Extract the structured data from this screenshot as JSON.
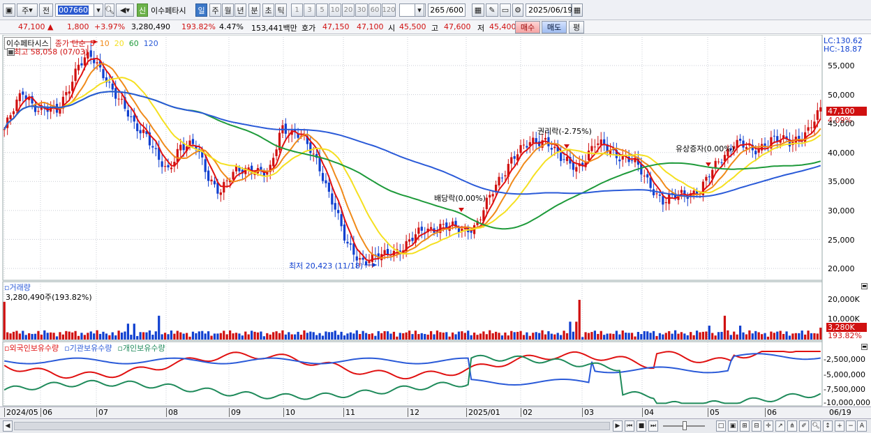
{
  "toolbar": {
    "market": "주",
    "prev": "전",
    "code": "007660",
    "new_badge": "신",
    "name": "이수페타시",
    "periods": [
      "일",
      "주",
      "월",
      "년",
      "분",
      "초",
      "틱"
    ],
    "intervals": [
      "1",
      "3",
      "5",
      "10",
      "20",
      "30",
      "60",
      "120"
    ],
    "count": "265",
    "count_max": "/600",
    "date": "2025/06/19"
  },
  "quote": {
    "price": "47,100",
    "change_arrow": "▲",
    "change": "1,800",
    "change_pct": "+3.97%",
    "volume": "3,280,490",
    "volume_pct": "193.82%",
    "turnover": "4.47%",
    "amount": "153,441백만",
    "hoga_label": "호가",
    "ask": "47,150",
    "bid": "47,100",
    "open_label": "시",
    "open": "45,500",
    "high_label": "고",
    "high": "47,600",
    "low_label": "저",
    "low": "45,400",
    "buy": "매수",
    "sell": "매도",
    "eval": "평"
  },
  "chart": {
    "legend": {
      "stock": "이수페타시스",
      "close_label": "종가 단순",
      "ma": [
        {
          "label": "5",
          "color": "#e01010"
        },
        {
          "label": "10",
          "color": "#f08a1a"
        },
        {
          "label": "20",
          "color": "#f5e020"
        },
        {
          "label": "60",
          "color": "#1e9a3a"
        },
        {
          "label": "120",
          "color": "#2a5ad8"
        }
      ]
    },
    "high_note": "최고 58,058 (07/03)",
    "low_note": "최저 20,423 (11/18)",
    "events": [
      "배당락(0.00%)",
      "권리락(-2.75%)",
      "유상증자(0.00%)"
    ],
    "lc": "LC:130.62",
    "hc": "HC:-18.87",
    "last_price_tag": "47,100",
    "last_pct_tag": "4.09%",
    "y_ticks": [
      "55,000",
      "50,000",
      "45,000",
      "40,000",
      "35,000",
      "30,000",
      "25,000",
      "20,000"
    ]
  },
  "volume_panel": {
    "title": "거래량",
    "value": "3,280,490주(193.82%)",
    "y_ticks": [
      "20,000K",
      "10,000K"
    ],
    "last_tag": "3,280K",
    "last_pct": "193.82%"
  },
  "holdings_panel": {
    "legend": [
      {
        "label": "외국인보유수량",
        "color": "#e01010"
      },
      {
        "label": "기관보유수량",
        "color": "#2a5ad8"
      },
      {
        "label": "개인보유수량",
        "color": "#1e8a5a"
      }
    ],
    "y_ticks": [
      "-2,500,000",
      "-5,000,000",
      "-7,500,000",
      "-10,000,000"
    ]
  },
  "x_axis": {
    "labels": [
      "2024/05",
      "06",
      "07",
      "08",
      "09",
      "10",
      "11",
      "12",
      "2025/01",
      "02",
      "03",
      "04",
      "05",
      "06"
    ],
    "end_label": "06/19"
  },
  "colors": {
    "up": "#d01010",
    "down": "#1040d0",
    "ma5": "#e01010",
    "ma10": "#f08a1a",
    "ma20": "#f5e020",
    "ma60": "#1e9a3a",
    "ma120": "#2a5ad8"
  }
}
